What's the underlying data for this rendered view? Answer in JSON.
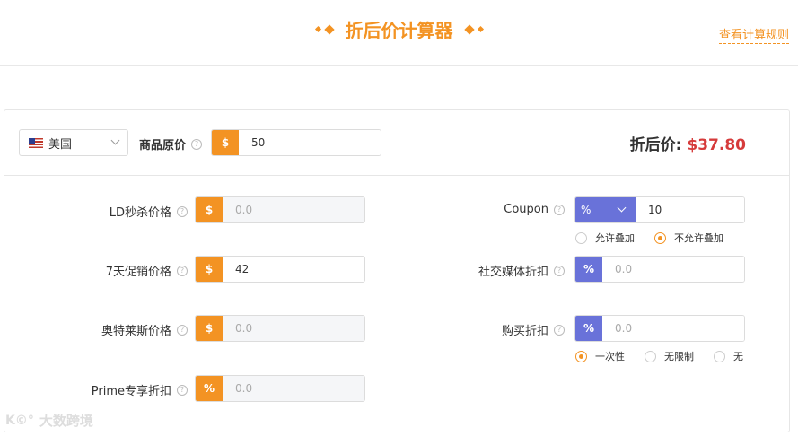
{
  "header": {
    "title": "折后价计算器",
    "rule_link": "查看计算规则"
  },
  "top": {
    "country": "美国",
    "original_price_label": "商品原价",
    "original_price_prefix": "$",
    "original_price_value": "50",
    "result_label": "折后价:",
    "result_value": "$37.80"
  },
  "left_fields": [
    {
      "label": "LD秒杀价格",
      "prefix": "$",
      "value": "",
      "placeholder": "0.0"
    },
    {
      "label": "7天促销价格",
      "prefix": "$",
      "value": "42",
      "placeholder": "0.0"
    },
    {
      "label": "奥特莱斯价格",
      "prefix": "$",
      "value": "",
      "placeholder": "0.0"
    },
    {
      "label": "Prime专享折扣",
      "prefix": "%",
      "value": "",
      "placeholder": "0.0"
    }
  ],
  "coupon": {
    "label": "Coupon",
    "type_selected": "%",
    "value": "10",
    "stack_options": [
      "允许叠加",
      "不允许叠加"
    ],
    "stack_selected": "不允许叠加"
  },
  "social": {
    "label": "社交媒体折扣",
    "prefix": "%",
    "placeholder": "0.0"
  },
  "purchase": {
    "label": "购买折扣",
    "prefix": "%",
    "placeholder": "0.0",
    "options": [
      "一次性",
      "无限制",
      "无"
    ],
    "selected": "一次性"
  },
  "watermark": {
    "logo": "K©°",
    "text": "大数跨境"
  },
  "colors": {
    "accent": "#f39323",
    "secondary": "#6972d9",
    "price": "#d63b3b"
  }
}
